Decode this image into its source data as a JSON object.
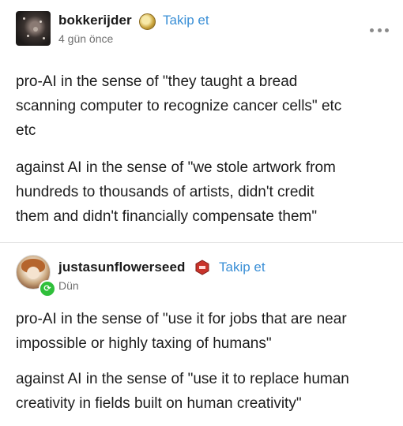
{
  "posts": [
    {
      "username": "bokkerijder",
      "follow_label": "Takip et",
      "time": "4 gün önce",
      "more_icon": "more-dots-icon",
      "paragraphs": [
        [
          "pro-AI in the sense of \"they taught a bread",
          "scanning computer to recognize cancer cells\" etc",
          "etc"
        ],
        [
          "against AI in the sense of \"we stole artwork from",
          "hundreds to thousands of artists, didn't credit",
          "them and didn't financially compensate them\""
        ]
      ]
    },
    {
      "username": "justasunflowerseed",
      "follow_label": "Takip et",
      "time": "Dün",
      "paragraphs": [
        [
          "pro-AI in the sense of \"use it for jobs that are near",
          "impossible or highly taxing of humans\""
        ],
        [
          "against AI in the sense of \"use it to replace human",
          "creativity in fields built on human creativity\""
        ]
      ]
    }
  ],
  "colors": {
    "follow": "#3a8fd6",
    "reblog_badge": "#2fbf3a",
    "divider": "#e3e3e3",
    "muted": "#707070"
  }
}
